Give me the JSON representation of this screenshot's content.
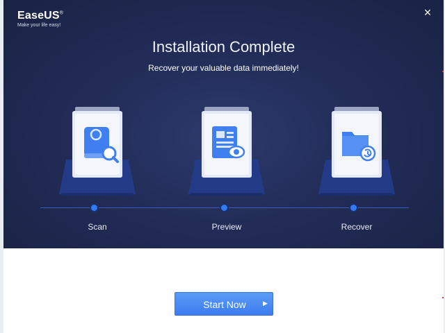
{
  "app": {
    "brand": "EaseUS",
    "brand_mark": "®",
    "tagline": "Make your life easy!"
  },
  "header": {
    "title": "Installation Complete",
    "subtitle": "Recover your valuable data immediately!"
  },
  "steps": [
    {
      "label": "Scan",
      "icon": "scan-disk-icon"
    },
    {
      "label": "Preview",
      "icon": "preview-document-icon"
    },
    {
      "label": "Recover",
      "icon": "recover-folder-icon"
    }
  ],
  "actions": {
    "start_label": "Start Now",
    "close_glyph": "×",
    "arrow_glyph": "▶"
  },
  "colors": {
    "hero_bg": "#222c57",
    "accent": "#2f7cf6",
    "button": "#4a8cf5"
  }
}
